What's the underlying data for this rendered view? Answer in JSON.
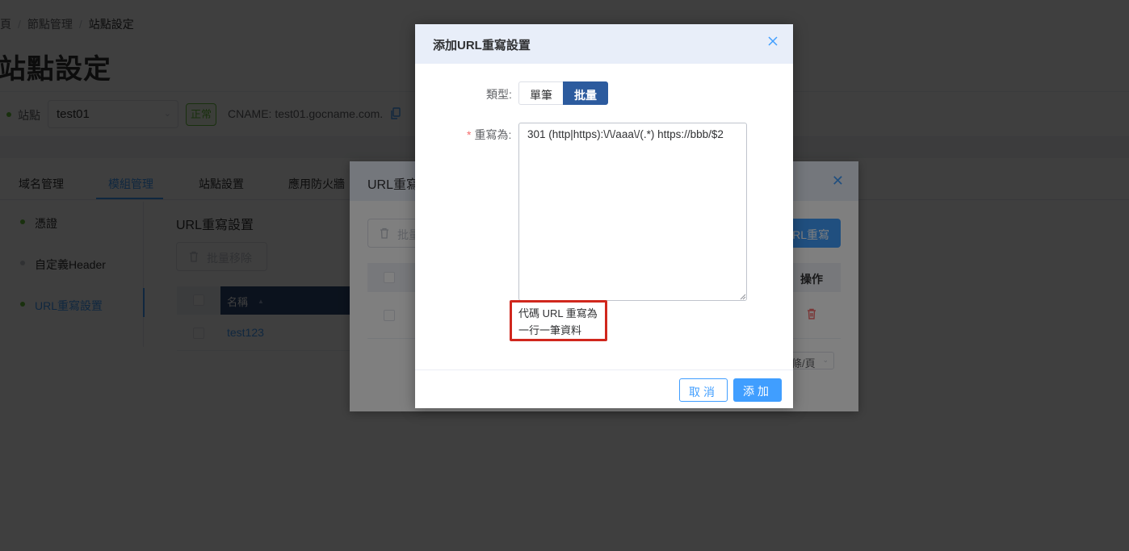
{
  "breadcrumb": {
    "home": "首頁",
    "level2": "節點管理",
    "current": "站點設定",
    "separator": "/"
  },
  "page_title": "站點設定",
  "site_bar": {
    "label": "站點",
    "selected_site": "test01",
    "status": "正常",
    "cname": "CNAME: test01.gocname.com."
  },
  "tabs": [
    {
      "label": "域名管理"
    },
    {
      "label": "模組管理",
      "active": true
    },
    {
      "label": "站點設置"
    },
    {
      "label": "應用防火牆"
    }
  ],
  "side_nav": [
    {
      "label": "憑證"
    },
    {
      "label": "自定義Header"
    },
    {
      "label": "URL重寫設置",
      "active": true
    }
  ],
  "section": {
    "title": "URL重寫設置",
    "bulk_remove": "批量移除",
    "col_name": "名稱",
    "rows": [
      {
        "name": "test123"
      }
    ]
  },
  "rewrite_dialog": {
    "title": "URL重寫",
    "bulk_button": "批量",
    "add_button": "URL重寫",
    "col_ops": "操作",
    "page_size": "條/頁"
  },
  "add_dialog": {
    "title": "添加URL重寫設置",
    "type_label": "類型:",
    "type_options": [
      "單筆",
      "批量"
    ],
    "type_selected": "批量",
    "rewrite_label": "重寫為:",
    "required_mark": "*",
    "rewrite_value": "301 (http|https):\\/\\/aaa\\/(.*) https://bbb/$2",
    "hint_line1": "代碼 URL 重寫為",
    "hint_line2": "一行一筆資料",
    "cancel": "取消",
    "confirm": "添加"
  },
  "colors": {
    "primary": "#409eff",
    "success": "#67c23a",
    "danger": "#f56c6c",
    "hint_border": "#d0271d",
    "segment_active": "#2c5b9e"
  }
}
